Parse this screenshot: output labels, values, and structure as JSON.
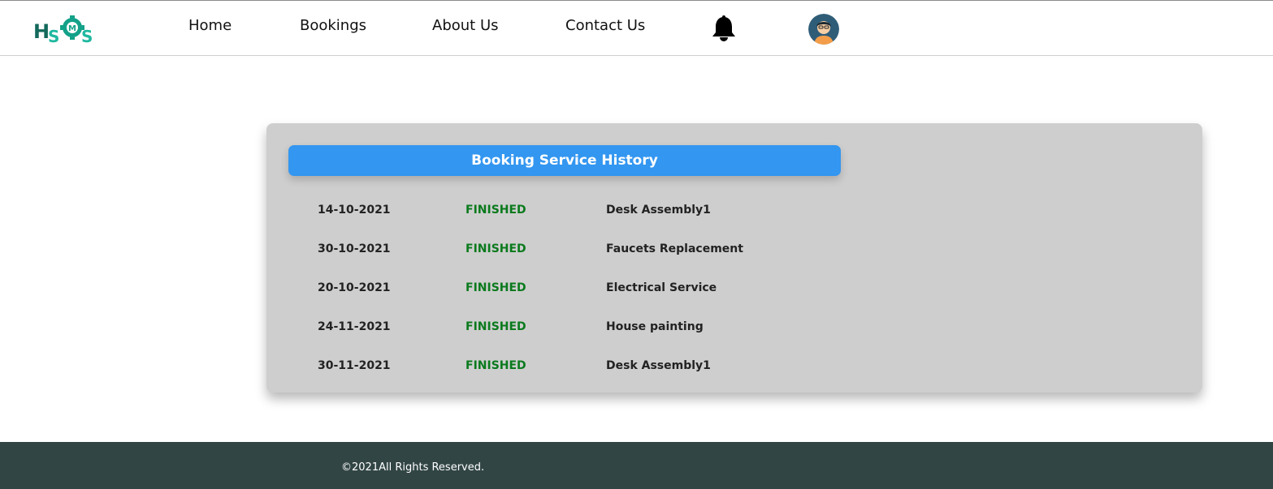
{
  "nav": {
    "logo_text": "HSMS",
    "links": [
      "Home",
      "Bookings",
      "About Us",
      "Contact Us"
    ],
    "notification_icon": "bell-icon",
    "avatar_icon": "user-avatar-icon"
  },
  "history": {
    "title": "Booking Service History",
    "rows": [
      {
        "date": "14-10-2021",
        "status": "FINISHED",
        "service": "Desk Assembly1"
      },
      {
        "date": "30-10-2021",
        "status": "FINISHED",
        "service": "Faucets Replacement"
      },
      {
        "date": "20-10-2021",
        "status": "FINISHED",
        "service": "Electrical Service"
      },
      {
        "date": "24-11-2021",
        "status": "FINISHED",
        "service": "House painting"
      },
      {
        "date": "30-11-2021",
        "status": "FINISHED",
        "service": "Desk Assembly1"
      }
    ]
  },
  "footer": {
    "text": "©2021All Rights Reserved."
  },
  "colors": {
    "header_blue": "#3396f0",
    "status_green": "#0a7a1d",
    "card_gray": "#cecece",
    "footer_dark": "#324545",
    "logo_teal": "#13a189"
  }
}
